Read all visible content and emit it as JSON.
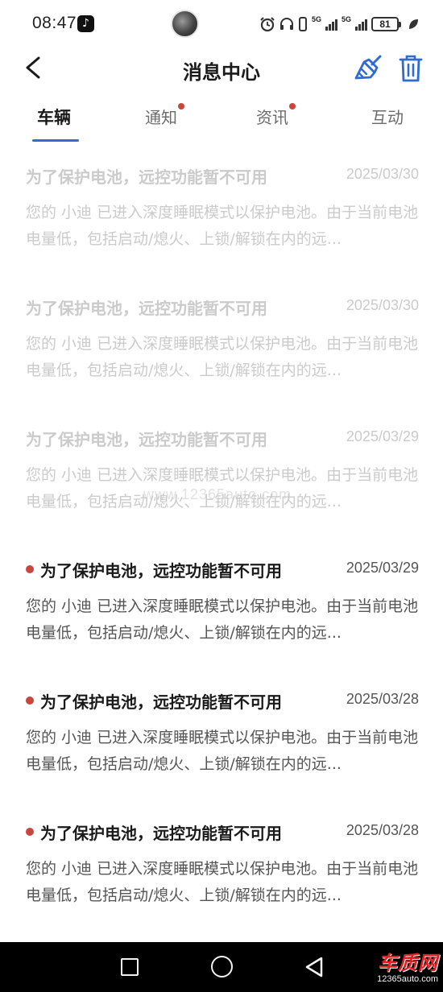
{
  "status_bar": {
    "time": "08:47",
    "signal_1": "5G",
    "signal_2": "5G",
    "battery": "81"
  },
  "header": {
    "title": "消息中心"
  },
  "tabs": [
    {
      "label": "车辆",
      "active": true,
      "badge": false
    },
    {
      "label": "通知",
      "active": false,
      "badge": true
    },
    {
      "label": "资讯",
      "active": false,
      "badge": true
    },
    {
      "label": "互动",
      "active": false,
      "badge": false
    }
  ],
  "messages": [
    {
      "title": "为了保护电池，远控功能暂不可用",
      "date": "2025/03/30",
      "body": "您的 小迪 已进入深度睡眠模式以保护电池。由于当前电池电量低，包括启动/熄火、上锁/解锁在内的远...",
      "unread": false
    },
    {
      "title": "为了保护电池，远控功能暂不可用",
      "date": "2025/03/30",
      "body": "您的 小迪 已进入深度睡眠模式以保护电池。由于当前电池电量低，包括启动/熄火、上锁/解锁在内的远...",
      "unread": false
    },
    {
      "title": "为了保护电池，远控功能暂不可用",
      "date": "2025/03/29",
      "body": "您的 小迪 已进入深度睡眠模式以保护电池。由于当前电池电量低，包括启动/熄火、上锁/解锁在内的远...",
      "unread": false
    },
    {
      "title": "为了保护电池，远控功能暂不可用",
      "date": "2025/03/29",
      "body": "您的 小迪 已进入深度睡眠模式以保护电池。由于当前电池电量低，包括启动/熄火、上锁/解锁在内的远...",
      "unread": true
    },
    {
      "title": "为了保护电池，远控功能暂不可用",
      "date": "2025/03/28",
      "body": "您的 小迪 已进入深度睡眠模式以保护电池。由于当前电池电量低，包括启动/熄火、上锁/解锁在内的远...",
      "unread": true
    },
    {
      "title": "为了保护电池，远控功能暂不可用",
      "date": "2025/03/28",
      "body": "您的 小迪 已进入深度睡眠模式以保护电池。由于当前电池电量低，包括启动/熄火、上锁/解锁在内的远...",
      "unread": true
    }
  ],
  "watermark": "www.12365auto.com",
  "brand": {
    "name": "车质网",
    "url": "12365auto.com"
  },
  "colors": {
    "accent": "#2f6bd2",
    "badge": "#c9463d",
    "read_text": "#cbcbcb",
    "nav_background": "#000000"
  }
}
